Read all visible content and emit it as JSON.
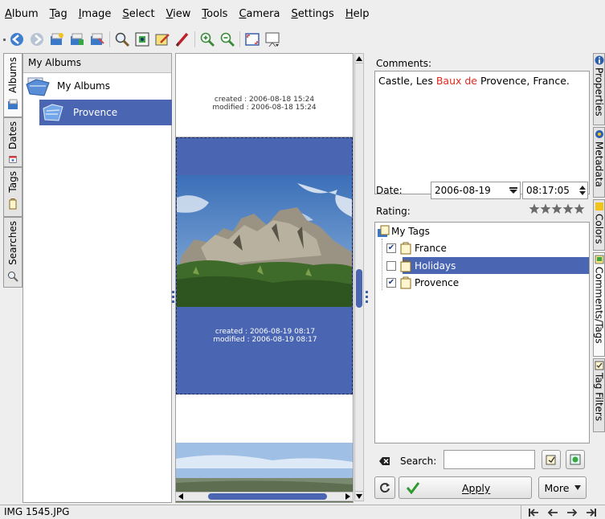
{
  "menu": [
    "Album",
    "Tag",
    "Image",
    "Select",
    "View",
    "Tools",
    "Camera",
    "Settings",
    "Help"
  ],
  "toolbar_icons": [
    "back-icon",
    "forward-icon",
    "new-album-icon",
    "album-properties-icon",
    "album-icon",
    "search-icon",
    "view-image-icon",
    "edit-image-icon",
    "pencil-icon",
    "zoom-in-icon",
    "zoom-out-icon",
    "fullscreen-icon",
    "slideshow-icon"
  ],
  "left_tabs": [
    "Albums",
    "Dates",
    "Tags",
    "Searches"
  ],
  "albums": {
    "header": "My Albums",
    "root": "My Albums",
    "child": "Provence"
  },
  "thumbs": [
    {
      "created": "created : 2006-08-18 15:24",
      "modified": "modified : 2006-08-18 15:24"
    },
    {
      "created": "created : 2006-08-19 08:17",
      "modified": "modified : 2006-08-19 08:17"
    }
  ],
  "sidebar": {
    "comments_label": "Comments:",
    "comment": {
      "before": "Castle, Les ",
      "highlight": "Baux de",
      "after": " Provence, France."
    },
    "date_label": "Date:",
    "date_value": "2006-08-19",
    "time_value": "08:17:05",
    "rating_label": "Rating:",
    "rating": 5,
    "tags_root": "My Tags",
    "tags": [
      {
        "name": "France",
        "checked": true
      },
      {
        "name": "Holidays",
        "checked": false
      },
      {
        "name": "Provence",
        "checked": true
      }
    ],
    "search_label": "Search:",
    "search_value": "",
    "apply_label": "Apply",
    "more_label": "More"
  },
  "right_tabs": [
    "Properties",
    "Metadata",
    "Colors",
    "Comments/Tags",
    "Tag Filters"
  ],
  "status": {
    "filename": "IMG 1545.JPG"
  },
  "colors": {
    "selection": "#4a66b3",
    "highlight_text": "#e0281e",
    "star": "#6b6b6b"
  }
}
